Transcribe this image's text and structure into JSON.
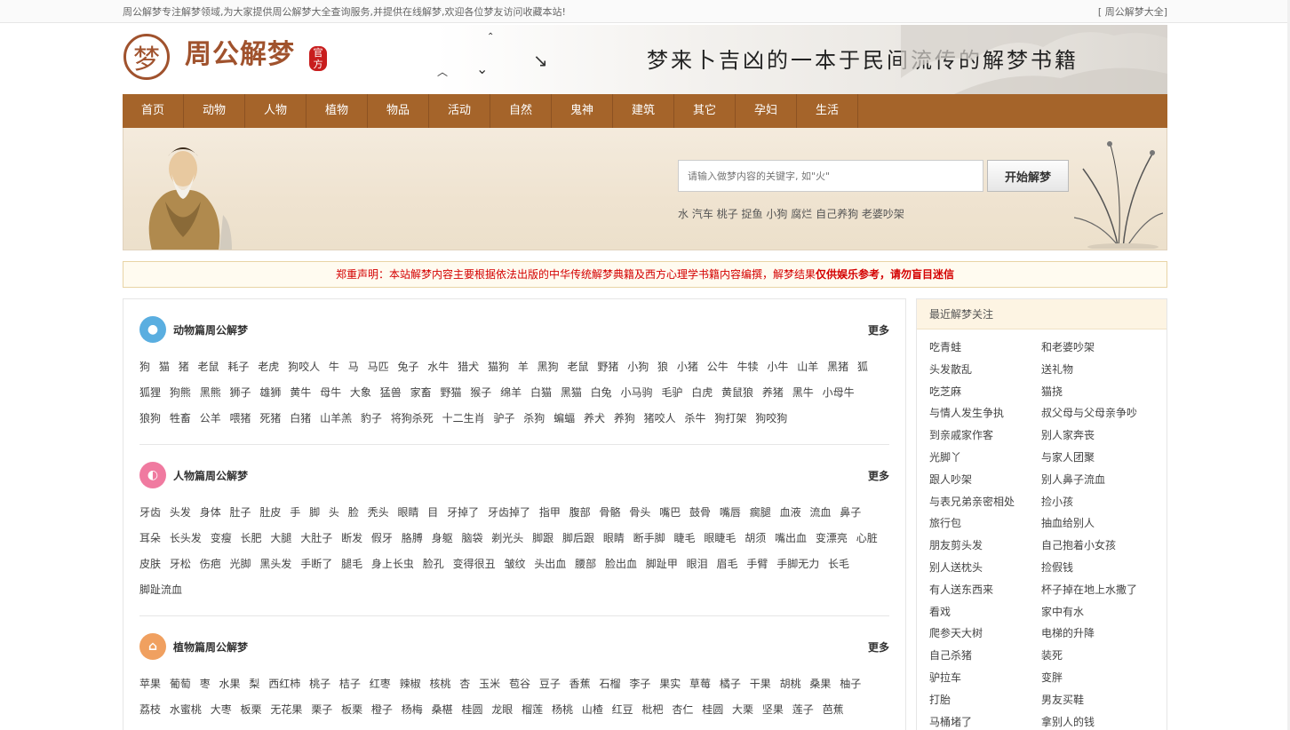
{
  "topbar": {
    "intro": "周公解梦专注解梦领域,为大家提供周公解梦大全查询服务,并提供在线解梦,欢迎各位梦友访问收藏本站!",
    "link": "[ 周公解梦大全]"
  },
  "header": {
    "logo_glyph": "梦",
    "logo_text": "周公解梦",
    "seal": "官方",
    "slogan": "梦来卜吉凶的一本于民间流传的解梦书籍"
  },
  "nav": [
    "首页",
    "动物",
    "人物",
    "植物",
    "物品",
    "活动",
    "自然",
    "鬼神",
    "建筑",
    "其它",
    "孕妇",
    "生活"
  ],
  "search": {
    "placeholder": "请输入做梦内容的关键字, 如\"火\"",
    "button": "开始解梦",
    "hot": [
      "水",
      "汽车",
      "桃子",
      "捉鱼",
      "小狗",
      "腐烂",
      "自己养狗",
      "老婆吵架"
    ]
  },
  "notice": {
    "prefix": "郑重声明：本站解梦内容主要根据依法出版的中华传统解梦典籍及西方心理学书籍内容编撰，解梦结果",
    "bold": "仅供娱乐参考，请勿盲目迷信"
  },
  "sections": [
    {
      "title": "动物篇周公解梦",
      "more": "更多",
      "color": "#5aaee0",
      "icon": "people-icon",
      "tags": [
        "狗",
        "猫",
        "猪",
        "老鼠",
        "耗子",
        "老虎",
        "狗咬人",
        "牛",
        "马",
        "马匹",
        "兔子",
        "水牛",
        "猎犬",
        "猫狗",
        "羊",
        "黑狗",
        "老鼠",
        "野猪",
        "小狗",
        "狼",
        "小猪",
        "公牛",
        "牛犊",
        "小牛",
        "山羊",
        "黑猪",
        "狐",
        "狐狸",
        "狗熊",
        "黑熊",
        "狮子",
        "雄狮",
        "黄牛",
        "母牛",
        "大象",
        "猛兽",
        "家畜",
        "野猫",
        "猴子",
        "绵羊",
        "白猫",
        "黑猫",
        "白兔",
        "小马驹",
        "毛驴",
        "白虎",
        "黄鼠狼",
        "养猪",
        "黑牛",
        "小母牛",
        "狼狗",
        "牲畜",
        "公羊",
        "喂猪",
        "死猪",
        "白猪",
        "山羊羔",
        "豹子",
        "将狗杀死",
        "十二生肖",
        "驴子",
        "杀狗",
        "蝙蝠",
        "养犬",
        "养狗",
        "猪咬人",
        "杀牛",
        "狗打架",
        "狗咬狗"
      ]
    },
    {
      "title": "人物篇周公解梦",
      "more": "更多",
      "color": "#f07aa0",
      "icon": "ring-icon",
      "tags": [
        "牙齿",
        "头发",
        "身体",
        "肚子",
        "肚皮",
        "手",
        "脚",
        "头",
        "脸",
        "秃头",
        "眼睛",
        "目",
        "牙掉了",
        "牙齿掉了",
        "指甲",
        "腹部",
        "骨骼",
        "骨头",
        "嘴巴",
        "鼓骨",
        "嘴唇",
        "瘸腿",
        "血液",
        "流血",
        "鼻子",
        "耳朵",
        "长头发",
        "变瘦",
        "长肥",
        "大腿",
        "大肚子",
        "断发",
        "假牙",
        "胳膊",
        "身躯",
        "脑袋",
        "剃光头",
        "脚跟",
        "脚后跟",
        "眼睛",
        "断手脚",
        "睫毛",
        "眼睫毛",
        "胡须",
        "嘴出血",
        "变漂亮",
        "心脏",
        "皮肤",
        "牙松",
        "伤疤",
        "光脚",
        "黑头发",
        "手断了",
        "腿毛",
        "身上长虫",
        "脸孔",
        "变得很丑",
        "皱纹",
        "头出血",
        "腰部",
        "脸出血",
        "脚趾甲",
        "眼泪",
        "眉毛",
        "手臂",
        "手脚无力",
        "长毛",
        "脚趾流血"
      ]
    },
    {
      "title": "植物篇周公解梦",
      "more": "更多",
      "color": "#f0a060",
      "icon": "leaf-icon",
      "tags": [
        "苹果",
        "葡萄",
        "枣",
        "水果",
        "梨",
        "西红柿",
        "桃子",
        "桔子",
        "红枣",
        "辣椒",
        "核桃",
        "杏",
        "玉米",
        "苞谷",
        "豆子",
        "香蕉",
        "石榴",
        "李子",
        "果实",
        "草莓",
        "橘子",
        "干果",
        "胡桃",
        "桑果",
        "柚子",
        "荔枝",
        "水蜜桃",
        "大枣",
        "板栗",
        "无花果",
        "栗子",
        "板栗",
        "橙子",
        "杨梅",
        "桑椹",
        "桂圆",
        "龙眼",
        "榴莲",
        "杨桃",
        "山楂",
        "红豆",
        "枇杷",
        "杏仁",
        "桂圆",
        "大栗",
        "坚果",
        "莲子",
        "芭蕉"
      ]
    }
  ],
  "recent": {
    "title": "最近解梦关注",
    "items": [
      "吃青蛙",
      "和老婆吵架",
      "头发散乱",
      "送礼物",
      "吃芝麻",
      "猫挠",
      "与情人发生争执",
      "叔父母与父母亲争吵",
      "到亲戚家作客",
      "别人家奔丧",
      "光脚丫",
      "与家人团聚",
      "跟人吵架",
      "别人鼻子流血",
      "与表兄弟亲密相处",
      "捡小孩",
      "旅行包",
      "抽血给别人",
      "朋友剪头发",
      "自己抱着小女孩",
      "别人送枕头",
      "捡假钱",
      "有人送东西来",
      "杯子掉在地上水撒了",
      "看戏",
      "家中有水",
      "爬参天大树",
      "电梯的升降",
      "自己杀猪",
      "装死",
      "驴拉车",
      "变胖",
      "打胎",
      "男友买鞋",
      "马桶堵了",
      "拿别人的钱"
    ]
  }
}
